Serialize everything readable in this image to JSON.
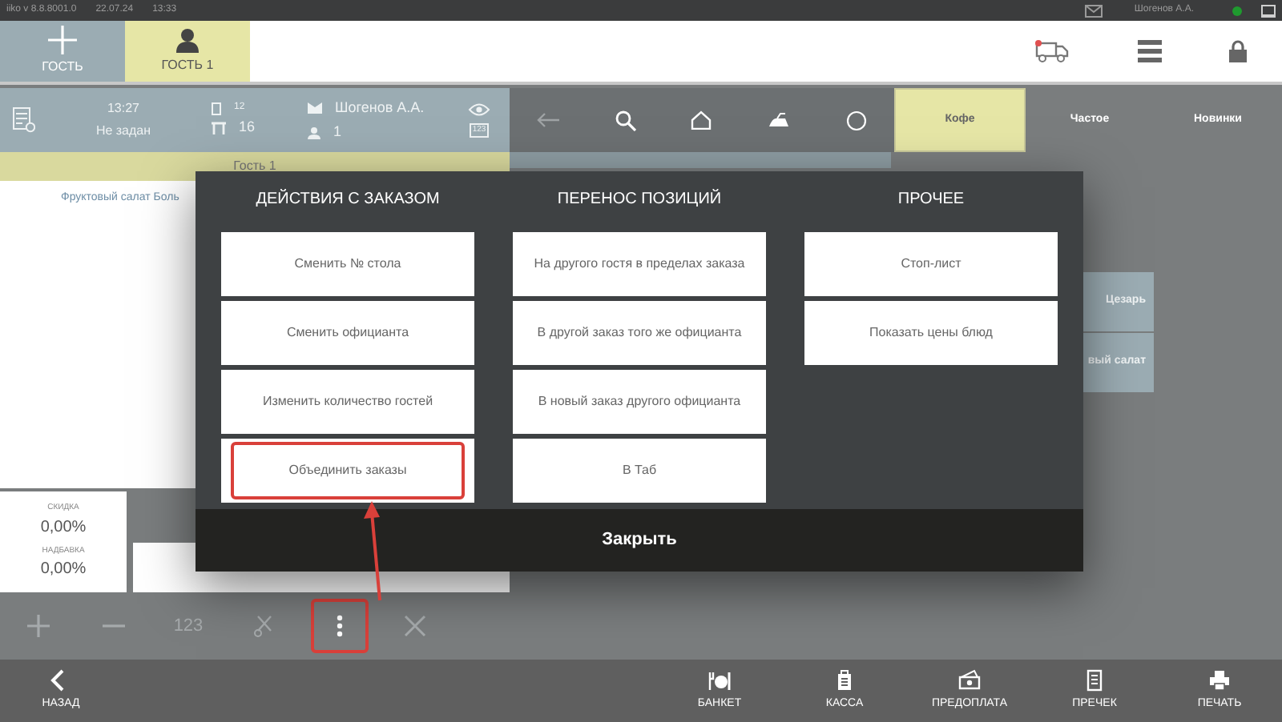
{
  "status_bar": {
    "app_version": "iiko v 8.8.8001.0",
    "date": "22.07.24",
    "time": "13:33",
    "user": "Шогенов А.А.",
    "online": true
  },
  "guest_tabs": [
    {
      "kind": "add",
      "label": "ГОСТЬ",
      "selected": false
    },
    {
      "kind": "guest",
      "label": "ГОСТЬ 1",
      "selected": true
    }
  ],
  "order_info": {
    "time": "13:27",
    "table_status": "Не задан",
    "table_number": "12",
    "seats": "16",
    "waiter": "Шогенов А.А.",
    "guests": "1",
    "badge": "123"
  },
  "guest_section": {
    "label": "Гость 1"
  },
  "order_items": [
    "Фруктовый салат Боль"
  ],
  "totals": {
    "discount_label": "СКИДКА",
    "discount": "0,00%",
    "markup_label": "НАДБАВКА",
    "markup": "0,00%"
  },
  "toolbar": [
    {
      "kind": "plus",
      "highlighted": false
    },
    {
      "kind": "minus",
      "highlighted": false
    },
    {
      "kind": "keypad",
      "label": "123",
      "highlighted": false
    },
    {
      "kind": "scissors",
      "highlighted": false
    },
    {
      "kind": "more",
      "highlighted": true
    },
    {
      "kind": "delete",
      "highlighted": false
    }
  ],
  "categories": [
    {
      "label": "Кофе",
      "selected": true
    },
    {
      "label": "Частое",
      "selected": false
    },
    {
      "label": "Новинки",
      "selected": false
    }
  ],
  "products": [
    "Цезарь",
    "вый салат"
  ],
  "modal": {
    "columns": [
      {
        "title": "ДЕЙСТВИЯ С ЗАКАЗОМ",
        "buttons": [
          {
            "label": "Сменить № стола",
            "highlighted": false
          },
          {
            "label": "Сменить официанта",
            "highlighted": false
          },
          {
            "label": "Изменить количество гостей",
            "highlighted": false
          },
          {
            "label": "Объединить заказы",
            "highlighted": true
          }
        ]
      },
      {
        "title": "ПЕРЕНОС ПОЗИЦИЙ",
        "buttons": [
          {
            "label": "На другого гостя в пределах заказа",
            "highlighted": false
          },
          {
            "label": "В другой заказ того же официанта",
            "highlighted": false
          },
          {
            "label": "В новый заказ другого официанта",
            "highlighted": false
          },
          {
            "label": "В Таб",
            "highlighted": false
          }
        ]
      },
      {
        "title": "ПРОЧЕЕ",
        "buttons": [
          {
            "label": "Стоп-лист",
            "highlighted": false
          },
          {
            "label": "Показать цены блюд",
            "highlighted": false
          }
        ]
      }
    ],
    "close_label": "Закрыть"
  },
  "bottom_nav": [
    {
      "kind": "back",
      "label": "НАЗАД"
    },
    {
      "kind": "banquet",
      "label": "БАНКЕТ"
    },
    {
      "kind": "cash",
      "label": "КАССА"
    },
    {
      "kind": "prepay",
      "label": "ПРЕДОПЛАТА"
    },
    {
      "kind": "precheck",
      "label": "ПРЕЧЕК"
    },
    {
      "kind": "print",
      "label": "ПЕЧАТЬ"
    }
  ]
}
